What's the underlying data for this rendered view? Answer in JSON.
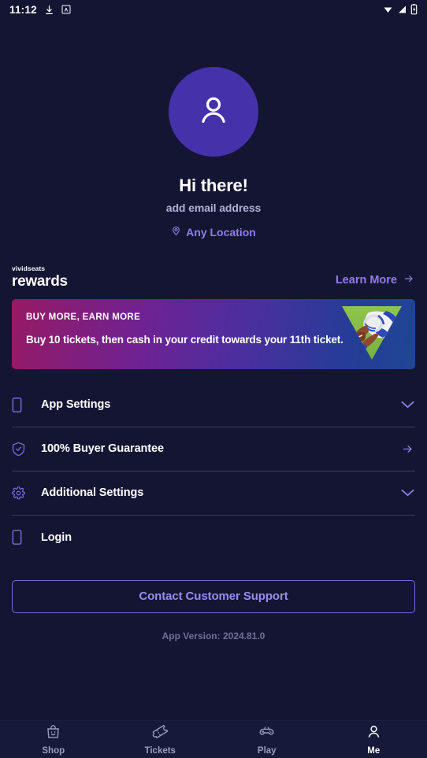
{
  "status_bar": {
    "time": "11:12",
    "left_icons": [
      "download-icon",
      "a-letter-icon"
    ],
    "right_icons": [
      "wifi-icon",
      "signal-icon",
      "battery-charging-icon"
    ]
  },
  "profile": {
    "avatar_icon": "person-icon",
    "avatar_color": "#4531aa",
    "greeting": "Hi there!",
    "email_prompt": "add email address",
    "location_icon": "location-pin-icon",
    "location": "Any Location",
    "accent_color": "#8f7fe8"
  },
  "rewards": {
    "brand_small": "vividseats",
    "brand_large": "rewards",
    "learn_more_label": "Learn More",
    "learn_more_icon": "arrow-right-icon"
  },
  "promo": {
    "kicker": "BUY MORE, EARN MORE",
    "body": "Buy 10 tickets, then cash in your credit towards your 11th ticket.",
    "art": "football-player-triangle-image",
    "gradient_start": "#961a64",
    "gradient_end": "#1f4695"
  },
  "settings_rows": [
    {
      "label": "App Settings",
      "icon": "phone-icon",
      "trailing": "chevron-down-icon"
    },
    {
      "label": "100% Buyer Guarantee",
      "icon": "shield-check-icon",
      "trailing": "arrow-right-icon"
    },
    {
      "label": "Additional Settings",
      "icon": "gear-icon",
      "trailing": "chevron-down-icon"
    },
    {
      "label": "Login",
      "icon": "phone-icon",
      "trailing": "none"
    }
  ],
  "support": {
    "button_label": "Contact Customer Support",
    "version": "App Version: 2024.81.0"
  },
  "bottom_nav": {
    "items": [
      {
        "label": "Shop",
        "icon": "shopping-bag-icon",
        "active": false
      },
      {
        "label": "Tickets",
        "icon": "ticket-icon",
        "active": false
      },
      {
        "label": "Play",
        "icon": "game-controller-icon",
        "active": false
      },
      {
        "label": "Me",
        "icon": "person-icon",
        "active": true
      }
    ]
  }
}
